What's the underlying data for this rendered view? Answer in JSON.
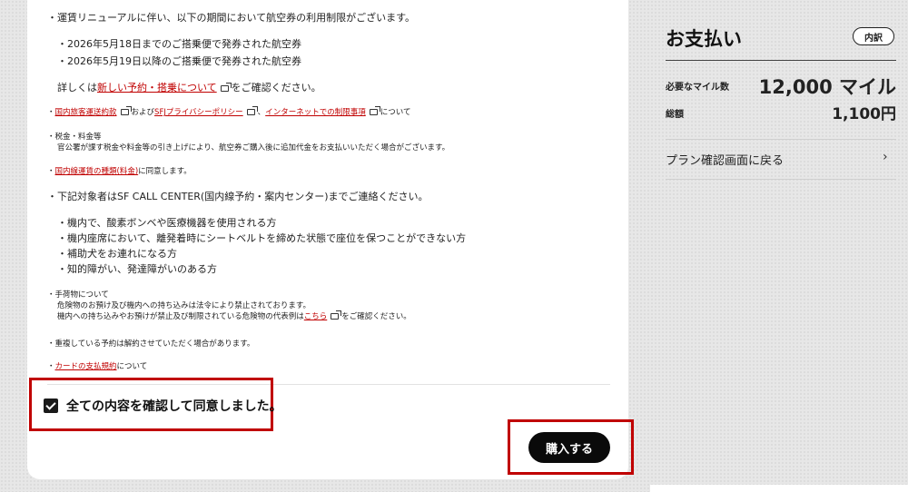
{
  "notices": {
    "fare_renewal": "・運賃リニューアルに伴い、以下の期間において航空券の利用制限がございます。",
    "ticket_a": "・2026年5月18日までのご搭乗便で発券された航空券",
    "ticket_b": "・2026年5月19日以降のご搭乗便で発券された航空券",
    "details_prefix": "詳しくは",
    "details_link": "新しい予約・搭乗について",
    "details_suffix": "をご確認ください。",
    "terms_bullet": "・",
    "terms_link1": "国内旅客運送約款",
    "terms_and": "および",
    "terms_link2": "SFJプライバシーポリシー",
    "terms_comma": "、",
    "terms_link3": "インターネットでの制限事項",
    "terms_suffix": "について",
    "tax_title": "・税金・料金等",
    "tax_body": "官公署が課す税金や料金等の引き上げにより、航空券ご購入後に追加代金をお支払いいただく場合がございます。",
    "fare_type_bullet": "・",
    "fare_type_link": "国内線運賃の種類(料金)",
    "fare_type_suffix": "に同意します。",
    "contact": "・下記対象者はSF CALL CENTER(国内線予約・案内センター)までご連絡ください。",
    "target1": "・機内で、酸素ボンベや医療機器を使用される方",
    "target2": "・機内座席において、離発着時にシートベルトを締めた状態で座位を保つことができない方",
    "target3": "・補助犬をお連れになる方",
    "target4": "・知的障がい、発達障がいのある方",
    "baggage_title": "・手荷物について",
    "baggage_line1": "危険物のお預け及び機内への持ち込みは法令により禁止されております。",
    "baggage_line2_prefix": "機内への持ち込みやお預けが禁止及び制限されている危険物の代表例は",
    "baggage_link": "こちら",
    "baggage_line2_suffix": "をご確認ください。",
    "duplicate": "・重複している予約は解約させていただく場合があります。",
    "card_bullet": "・",
    "card_link": "カードの支払規約",
    "card_suffix": "について"
  },
  "agreement": {
    "checked": true,
    "label": "全ての内容を確認して同意しました。"
  },
  "purchase_button": "購入する",
  "payment": {
    "title": "お支払い",
    "breakdown_button": "内訳",
    "miles_label": "必要なマイル数",
    "miles_value": "12,000 マイル",
    "total_label": "総額",
    "total_value": "1,100円",
    "back_link": "プラン確認画面に戻る"
  },
  "colors": {
    "link": "#c00000",
    "highlight_border": "#c00000",
    "button_bg": "#0a0a0a"
  },
  "icons": {
    "external_link": "external-link-icon",
    "checkbox": "checkbox-checked-icon",
    "chevron": "chevron-right-icon"
  }
}
